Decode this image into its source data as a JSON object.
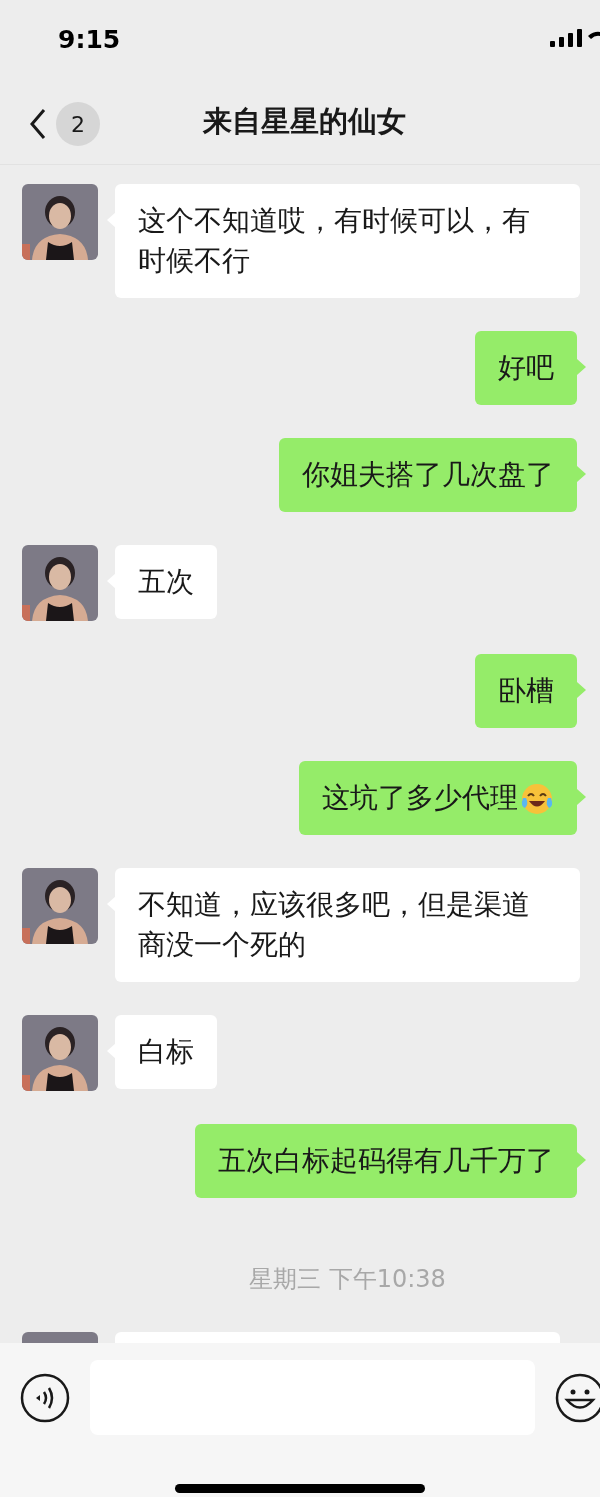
{
  "status_bar": {
    "time": "9:15"
  },
  "header": {
    "unread_badge": "2",
    "title": "来自星星的仙女"
  },
  "messages": [
    {
      "kind": "received",
      "text": "这个不知道哎，有时候可以，有时候不行"
    },
    {
      "kind": "sent",
      "text": "好吧"
    },
    {
      "kind": "sent",
      "text": "你姐夫搭了几次盘了"
    },
    {
      "kind": "received",
      "text": "五次"
    },
    {
      "kind": "sent",
      "text": "卧槽"
    },
    {
      "kind": "sent",
      "text": "这坑了多少代理",
      "emoji": true
    },
    {
      "kind": "received",
      "text": "不知道，应该很多吧，但是渠道商没一个死的"
    },
    {
      "kind": "received",
      "text": "白标"
    },
    {
      "kind": "sent",
      "text": "五次白标起码得有几千万了"
    },
    {
      "kind": "time",
      "text": "星期三 下午10:38"
    },
    {
      "kind": "received_cut"
    }
  ]
}
